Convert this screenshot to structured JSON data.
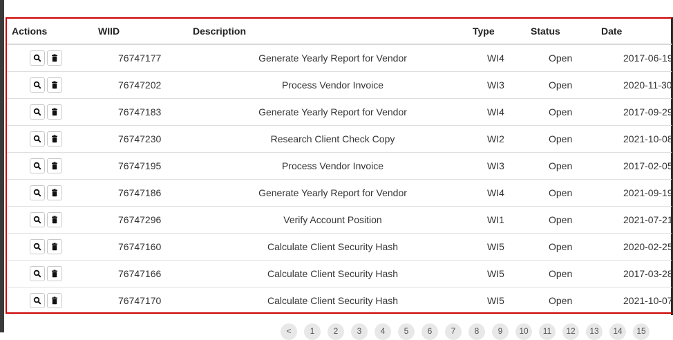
{
  "columns": {
    "actions": "Actions",
    "wiid": "WIID",
    "description": "Description",
    "type": "Type",
    "status": "Status",
    "date": "Date"
  },
  "icons": {
    "view": "magnifier-icon",
    "delete": "trash-icon"
  },
  "colors": {
    "highlight_border": "#cc0000"
  },
  "rows": [
    {
      "wiid": "76747177",
      "description": "Generate Yearly Report for Vendor",
      "type": "WI4",
      "status": "Open",
      "date": "2017-06-19"
    },
    {
      "wiid": "76747202",
      "description": "Process Vendor Invoice",
      "type": "WI3",
      "status": "Open",
      "date": "2020-11-30"
    },
    {
      "wiid": "76747183",
      "description": "Generate Yearly Report for Vendor",
      "type": "WI4",
      "status": "Open",
      "date": "2017-09-29"
    },
    {
      "wiid": "76747230",
      "description": "Research Client Check Copy",
      "type": "WI2",
      "status": "Open",
      "date": "2021-10-08"
    },
    {
      "wiid": "76747195",
      "description": "Process Vendor Invoice",
      "type": "WI3",
      "status": "Open",
      "date": "2017-02-05"
    },
    {
      "wiid": "76747186",
      "description": "Generate Yearly Report for Vendor",
      "type": "WI4",
      "status": "Open",
      "date": "2021-09-19"
    },
    {
      "wiid": "76747296",
      "description": "Verify Account Position",
      "type": "WI1",
      "status": "Open",
      "date": "2021-07-21"
    },
    {
      "wiid": "76747160",
      "description": "Calculate Client Security Hash",
      "type": "WI5",
      "status": "Open",
      "date": "2020-02-25"
    },
    {
      "wiid": "76747166",
      "description": "Calculate Client Security Hash",
      "type": "WI5",
      "status": "Open",
      "date": "2017-03-28"
    },
    {
      "wiid": "76747170",
      "description": "Calculate Client Security Hash",
      "type": "WI5",
      "status": "Open",
      "date": "2021-10-07"
    }
  ],
  "pagination": {
    "prev": "<",
    "pages": [
      "1",
      "2",
      "3",
      "4",
      "5",
      "6",
      "7",
      "8",
      "9",
      "10",
      "11",
      "12",
      "13",
      "14",
      "15"
    ]
  }
}
